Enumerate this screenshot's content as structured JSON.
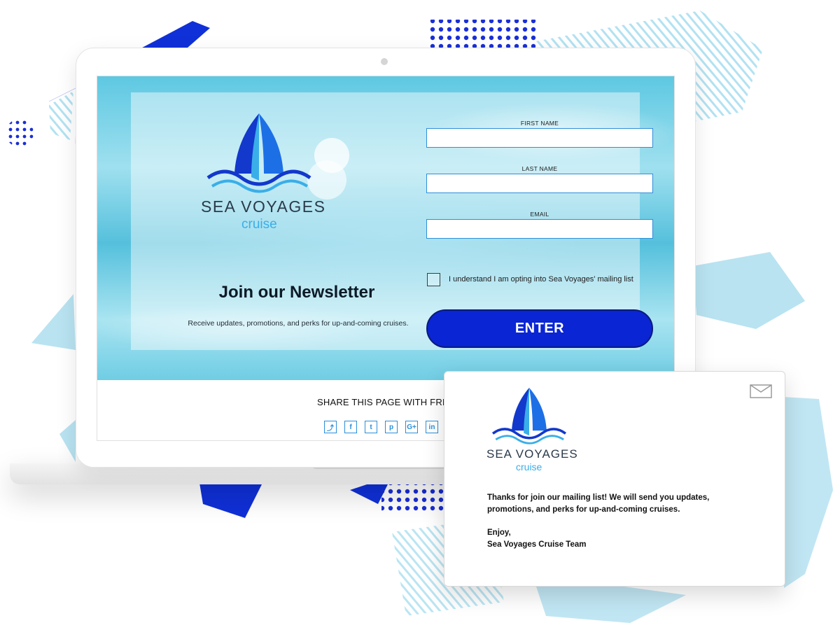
{
  "colors": {
    "accent_blue": "#0a25d4",
    "logo_dark_blue": "#1238cc",
    "logo_light_blue": "#3aaee8",
    "input_border": "#2d8fd8",
    "water_teal": "#5ec8e2"
  },
  "brand": {
    "name": "SEA  VOYAGES",
    "sub": "cruise",
    "logo_icon": "ship-sail-wave-logo"
  },
  "newsletter": {
    "headline": "Join our Newsletter",
    "subline": "Receive updates, promotions, and perks for up-and-coming cruises."
  },
  "form": {
    "first_name_label": "FIRST NAME",
    "first_name_value": "",
    "last_name_label": "LAST NAME",
    "last_name_value": "",
    "email_label": "EMAIL",
    "email_value": "",
    "consent_label": "I understand I am opting into Sea Voyages' mailing list",
    "consent_checked": false,
    "submit_label": "ENTER"
  },
  "share": {
    "title": "SHARE THIS PAGE WITH FRIENDS",
    "icons": [
      {
        "name": "share-icon",
        "glyph": "⤴"
      },
      {
        "name": "facebook-icon",
        "glyph": "f"
      },
      {
        "name": "twitter-icon",
        "glyph": "t"
      },
      {
        "name": "pinterest-icon",
        "glyph": "p"
      },
      {
        "name": "google-plus-icon",
        "glyph": "G+"
      },
      {
        "name": "linkedin-icon",
        "glyph": "in"
      }
    ]
  },
  "email_card": {
    "envelope_icon": "envelope-icon",
    "brand_name": "SEA  VOYAGES",
    "brand_sub": "cruise",
    "message": "Thanks for join our mailing list! We will send you updates, promotions, and perks for up-and-coming cruises.",
    "closing": "Enjoy,",
    "signature": "Sea Voyages Cruise Team"
  }
}
